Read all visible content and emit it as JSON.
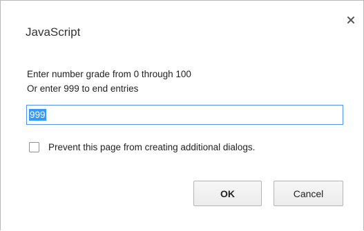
{
  "dialog": {
    "title": "JavaScript",
    "close_icon": "close-icon",
    "message_lines": [
      "Enter number grade from 0 through 100",
      "Or enter 999 to end entries"
    ],
    "input": {
      "value": "999",
      "selected": true
    },
    "checkbox": {
      "label": "Prevent this page from creating additional dialogs.",
      "checked": false
    },
    "buttons": {
      "ok_label": "OK",
      "cancel_label": "Cancel"
    },
    "colors": {
      "focus_border": "#4d90fe",
      "selection": "#3399ff"
    }
  }
}
